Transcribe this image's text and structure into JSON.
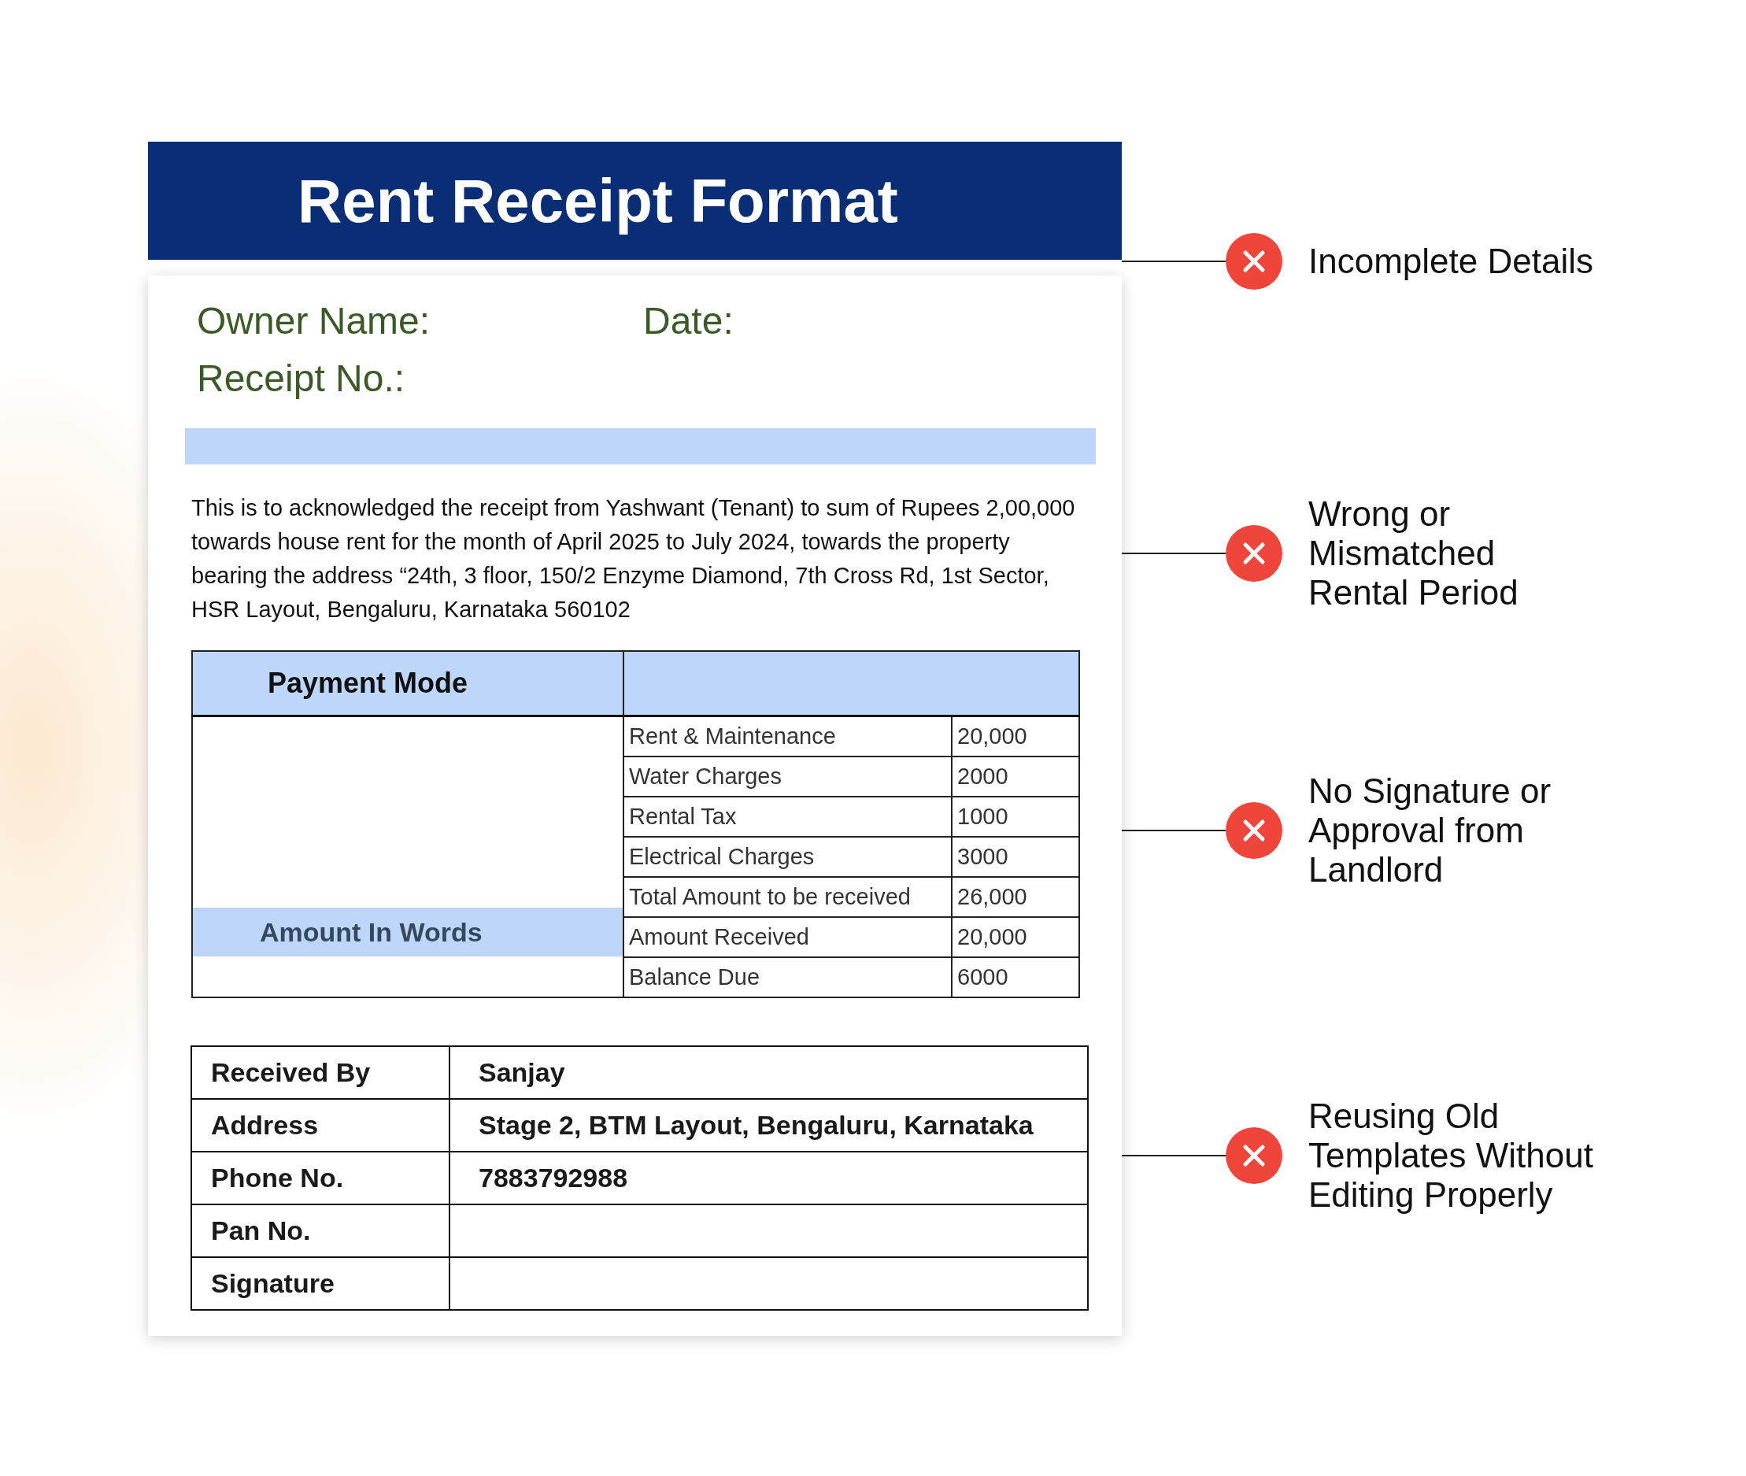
{
  "header": {
    "title": "Rent Receipt Format"
  },
  "fields": [
    {
      "label": "Owner Name:"
    },
    {
      "label": "Date:"
    },
    {
      "label": "Receipt No.:"
    }
  ],
  "paragraph": "This is to acknowledged the receipt from Yashwant (Tenant) to sum of Rupees 2,00,000 towards house rent for the month of April 2025 to July 2024, towards the property bearing the address “24th, 3 floor, 150/2 Enzyme Diamond, 7th Cross Rd, 1st Sector, HSR Layout, Bengaluru, Karnataka 560102",
  "payment_table": {
    "header": "Payment Mode",
    "amount_in_words_label": "Amount In Words",
    "rows": [
      {
        "item": "Rent & Maintenance",
        "amount": "20,000"
      },
      {
        "item": "Water Charges",
        "amount": "2000"
      },
      {
        "item": "Rental Tax",
        "amount": "1000"
      },
      {
        "item": "Electrical Charges",
        "amount": "3000"
      },
      {
        "item": "Total Amount to be received",
        "amount": "26,000"
      },
      {
        "item": "Amount Received",
        "amount": "20,000"
      },
      {
        "item": "Balance Due",
        "amount": "6000"
      }
    ]
  },
  "details_table": {
    "rows": [
      {
        "label": "Received By",
        "value": "Sanjay"
      },
      {
        "label": "Address",
        "value": "Stage 2, BTM Layout, Bengaluru, Karnataka"
      },
      {
        "label": "Phone No.",
        "value": "7883792988"
      },
      {
        "label": "Pan No."
      },
      {
        "label": "Signature"
      }
    ]
  },
  "callouts": [
    {
      "lines": [
        "Incomplete Details"
      ]
    },
    {
      "lines": [
        "Wrong or",
        "Mismatched",
        "Rental Period"
      ]
    },
    {
      "lines": [
        "No Signature or",
        "Approval from",
        "Landlord"
      ]
    },
    {
      "lines": [
        "Reusing Old",
        "Templates Without",
        "Editing Properly"
      ]
    }
  ]
}
